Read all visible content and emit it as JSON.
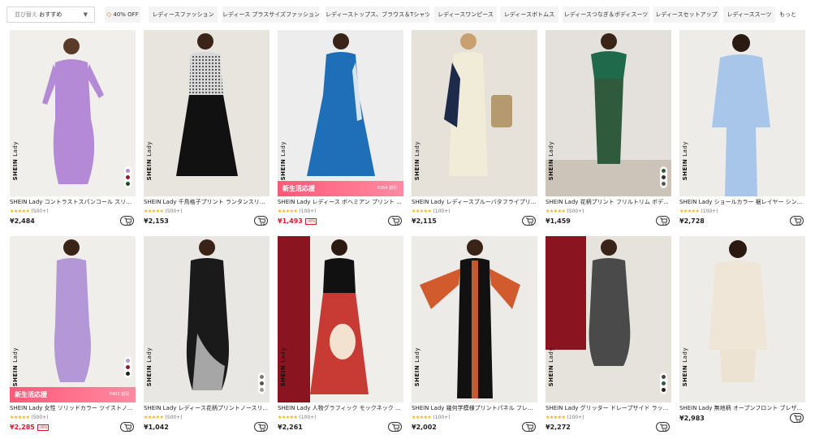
{
  "filter": {
    "sort_label": "並び替え",
    "sort_value": "おすすめ",
    "chips": [
      "40% OFF",
      "レディースファッション",
      "レディース プラスサイズファッション",
      "レディーストップス、ブラウス＆Tシャツ",
      "レディースワンピース",
      "レディースボトムス",
      "レディースつなぎ＆ボディスーツ",
      "レディースセットアップ",
      "レディーススーツ"
    ],
    "more": "もっと"
  },
  "products": [
    {
      "title": "SHEIN Lady コントラストスパンコール スリー...",
      "rating_count": "(500+)",
      "price": "¥2,484",
      "sale": false,
      "promo": null
    },
    {
      "title": "SHEIN Lady 千鳥格子プリント ランタンスリー...",
      "rating_count": "(500+)",
      "price": "¥2,153",
      "sale": false,
      "promo": null
    },
    {
      "title": "SHEIN Lady レディース ボヘミアン プリント ...",
      "rating_count": "(100+)",
      "price": "¥1,493",
      "sale": true,
      "off": "-40%",
      "promo": {
        "label": "新生活応援",
        "price": "¥264 割引"
      }
    },
    {
      "title": "SHEIN Lady レディースブルーバタフライプリ...",
      "rating_count": "(100+)",
      "price": "¥2,115",
      "sale": false,
      "promo": null
    },
    {
      "title": "SHEIN Lady 花柄プリント フリルトリム ボデ...",
      "rating_count": "(500+)",
      "price": "¥1,459",
      "sale": false,
      "promo": null
    },
    {
      "title": "SHEIN Lady ショールカラー 裾レイヤー シン...",
      "rating_count": "(100+)",
      "price": "¥2,728",
      "sale": false,
      "promo": null
    },
    {
      "title": "SHEIN Lady 女性 ソリッドカラー ツイストノ...",
      "rating_count": "(500+)",
      "price": "¥2,285",
      "sale": true,
      "off": "-40%",
      "promo": {
        "label": "新生活応援",
        "price": "¥403 割引"
      }
    },
    {
      "title": "SHEIN Lady レディース花柄プリントノースリ...",
      "rating_count": "(500+)",
      "price": "¥1,042",
      "sale": false,
      "promo": null
    },
    {
      "title": "SHEIN Lady 人物グラフィック モックネック ...",
      "rating_count": "(100+)",
      "price": "¥2,261",
      "sale": false,
      "promo": null
    },
    {
      "title": "SHEIN Lady 幾何学模様プリントパネル フレア...",
      "rating_count": "(100+)",
      "price": "¥2,002",
      "sale": false,
      "promo": null
    },
    {
      "title": "SHEIN Lady グリッター ドレープサイド ラッ...",
      "rating_count": "(100+)",
      "price": "¥2,272",
      "sale": false,
      "promo": null
    },
    {
      "title": "SHEIN Lady 無地柄 オープンフロント ブレザ...",
      "rating_count": "",
      "price": "¥2,983",
      "sale": false,
      "promo": null
    }
  ],
  "brand_watermark": {
    "bold": "SHEIN",
    "light": "Lady"
  },
  "stars": "★★★★★",
  "colors": {
    "sale_price": "#e0162b",
    "star": "#f5b400",
    "promo_bg": "#ff6f8a"
  }
}
